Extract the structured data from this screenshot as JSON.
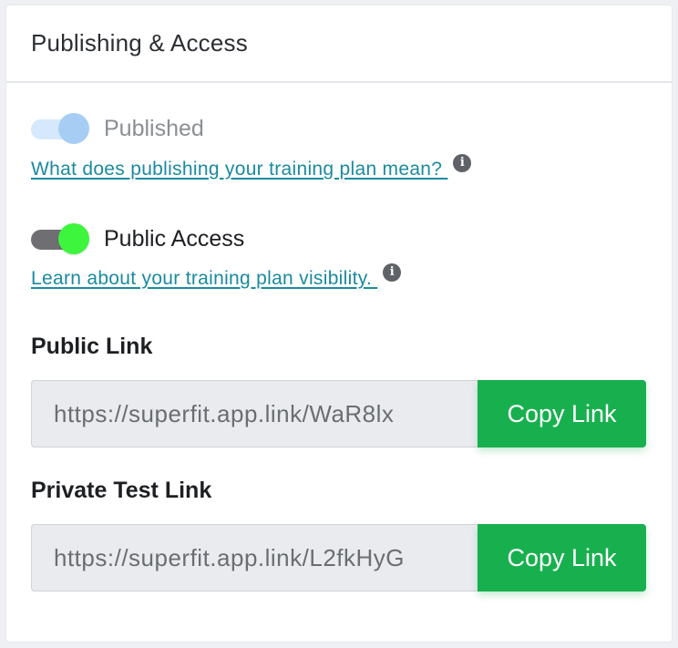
{
  "card": {
    "title": "Publishing & Access"
  },
  "published": {
    "label": "Published",
    "enabled": true,
    "disabled": true,
    "help_link": "What does publishing your training plan mean? "
  },
  "public_access": {
    "label": "Public Access",
    "enabled": true,
    "help_link": "Learn about your training plan visibility. "
  },
  "public_link": {
    "label": "Public Link",
    "value": "https://superfit.app.link/WaR8lx",
    "button": "Copy Link"
  },
  "private_test_link": {
    "label": "Private Test Link",
    "value": "https://superfit.app.link/L2fkHyG",
    "button": "Copy Link"
  },
  "icons": {
    "info": "i"
  },
  "colors": {
    "accent_green": "#18b04f",
    "toggle_on_knob": "#3df53d",
    "toggle_disabled_knob": "#a7cdf5",
    "link": "#1a8aa0"
  }
}
